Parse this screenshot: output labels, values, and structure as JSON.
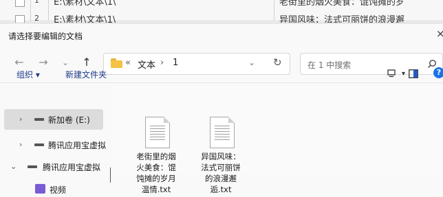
{
  "background_table": {
    "rows": [
      {
        "num": "1",
        "path": "E:\\素材\\文本\\1\\",
        "desc": "老街里的烟火美食：馄饨摊的岁"
      },
      {
        "num": "2",
        "path": "E:\\素材\\文本\\1\\",
        "desc": "异国风味：法式可丽饼的浪漫邂"
      }
    ]
  },
  "dialog": {
    "title": "请选择要编辑的文档",
    "close_symbol": "×"
  },
  "nav": {
    "back": "←",
    "forward": "→",
    "recent": "⌄",
    "up": "↑"
  },
  "address": {
    "prefix": "«",
    "crumbs": [
      "文本",
      "1"
    ],
    "separator": "›",
    "dropdown": "⌄",
    "refresh": "↻"
  },
  "search": {
    "placeholder": "在 1 中搜索"
  },
  "toolbar": {
    "organize": "组织 ▾",
    "new_folder": "新建文件夹",
    "view_dropdown": "▾"
  },
  "sidebar": {
    "items": [
      {
        "chevron": "›",
        "label": "新加卷 (E:)",
        "icon": "drive-icon"
      },
      {
        "chevron": "›",
        "label": "腾讯应用宝虚拟",
        "icon": "drive-icon"
      },
      {
        "chevron": "⌄",
        "label": "腾讯应用宝虚拟",
        "icon": "drive-icon"
      },
      {
        "chevron": "",
        "label": "视频",
        "icon": "video-icon"
      }
    ]
  },
  "files": [
    {
      "name_lines": [
        "老街里的烟",
        "火美食：馄",
        "饨摊的岁月",
        "温情.txt"
      ]
    },
    {
      "name_lines": [
        "异国风味：",
        "法式可丽饼",
        "的浪漫邂",
        "逅.txt"
      ]
    }
  ],
  "colors": {
    "folder": "#f5c243",
    "selection": "#dcdcdc",
    "toolbar_text": "#1e3a8a",
    "help_blue": "#1a73e8"
  }
}
